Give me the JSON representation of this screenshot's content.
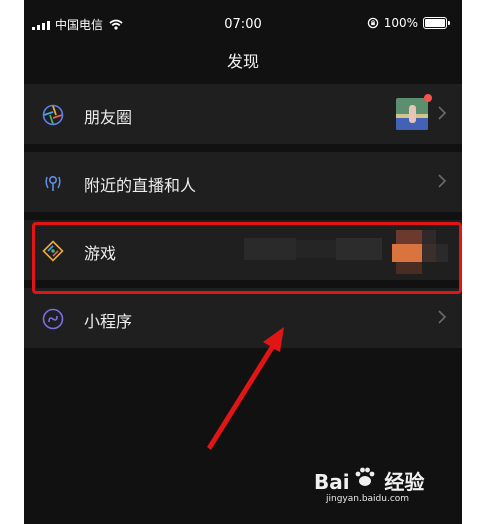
{
  "status_bar": {
    "carrier": "中国电信",
    "time": "07:00",
    "battery": "100%"
  },
  "nav": {
    "title": "发现"
  },
  "items": [
    {
      "label": "朋友圈",
      "icon": "moments-icon"
    },
    {
      "label": "附近的直播和人",
      "icon": "nearby-icon"
    },
    {
      "label": "游戏",
      "icon": "game-icon"
    },
    {
      "label": "小程序",
      "icon": "mini-program-icon"
    }
  ],
  "colors": {
    "background": "#111111",
    "row": "#1f1f1f",
    "highlight": "#e01515",
    "badge": "#fa5151"
  },
  "watermark": {
    "brand_logo_text": "Baidu经验",
    "url": "jingyan.baidu.com"
  }
}
